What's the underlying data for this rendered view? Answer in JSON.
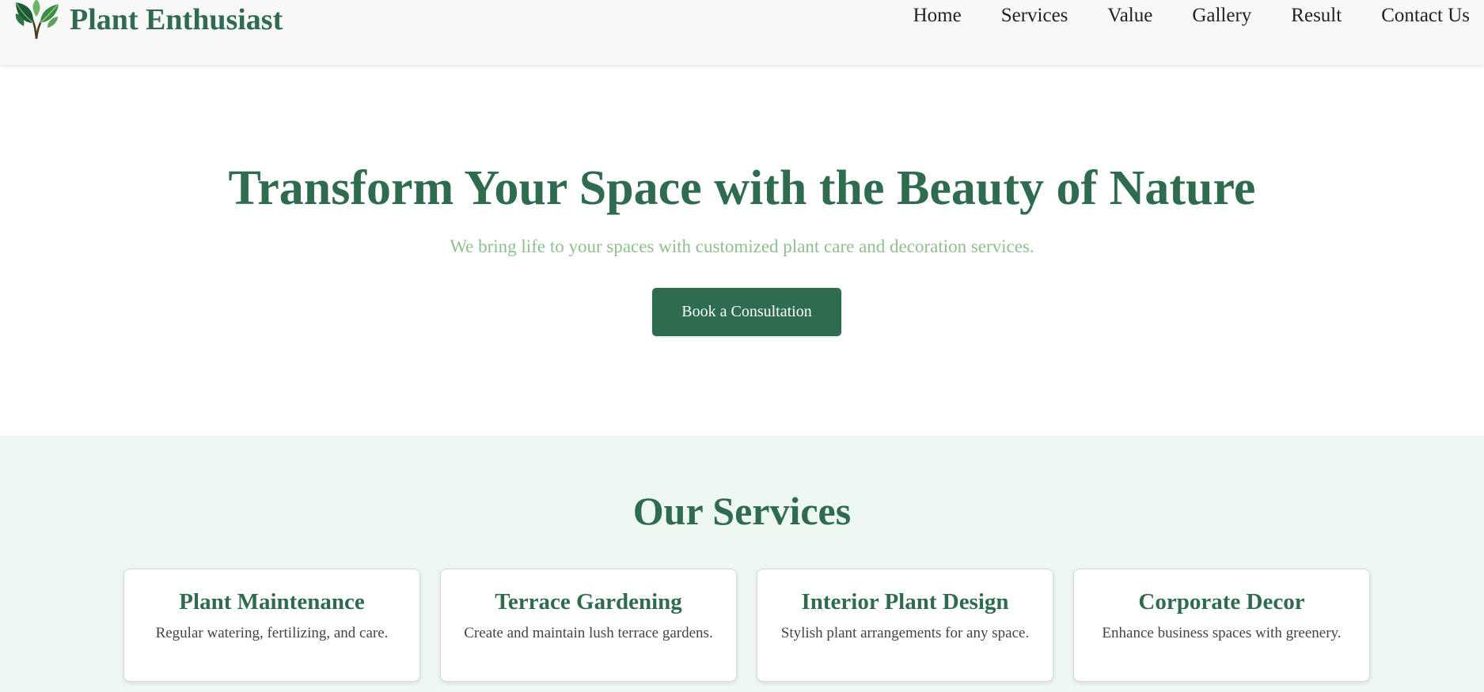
{
  "brand": {
    "name": "Plant Enthusiast",
    "logo_icon": "leaf-sprout-icon"
  },
  "nav": {
    "items": [
      {
        "label": "Home"
      },
      {
        "label": "Services"
      },
      {
        "label": "Value"
      },
      {
        "label": "Gallery"
      },
      {
        "label": "Result"
      },
      {
        "label": "Contact Us"
      }
    ]
  },
  "hero": {
    "title": "Transform Your Space with the Beauty of Nature",
    "subtitle": "We bring life to your spaces with customized plant care and decoration services.",
    "cta_label": "Book a Consultation"
  },
  "services": {
    "title": "Our Services",
    "cards": [
      {
        "title": "Plant Maintenance",
        "text": "Regular watering, fertilizing, and care."
      },
      {
        "title": "Terrace Gardening",
        "text": "Create and maintain lush terrace gardens."
      },
      {
        "title": "Interior Plant Design",
        "text": "Stylish plant arrangements for any space."
      },
      {
        "title": "Corporate Decor",
        "text": "Enhance business spaces with greenery."
      }
    ]
  },
  "colors": {
    "brand_green": "#2e6b4f",
    "subtitle_green": "#8fbf8f",
    "services_bg": "#eef8f2",
    "navbar_bg": "#f8f8f8"
  }
}
